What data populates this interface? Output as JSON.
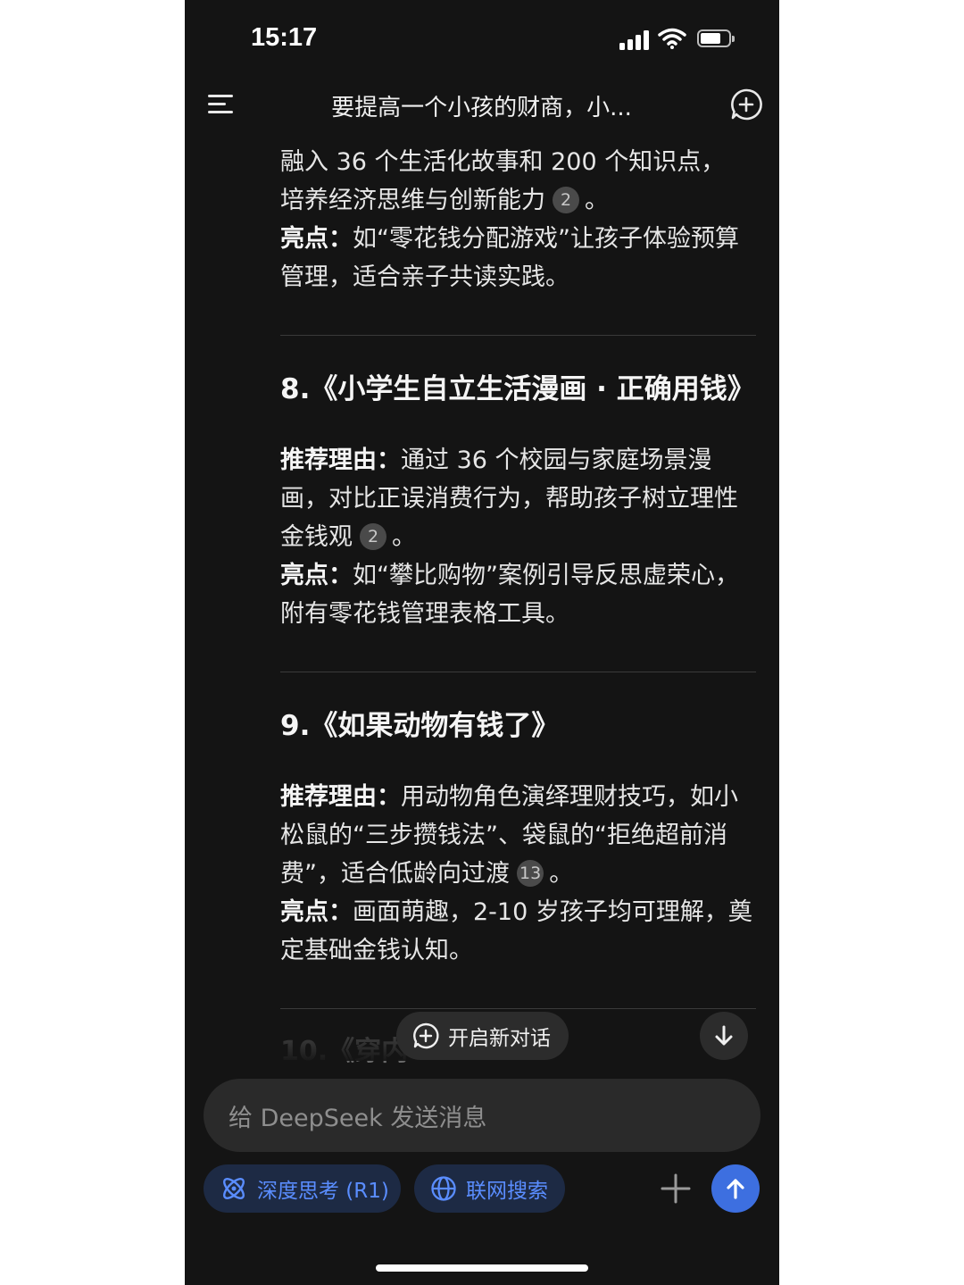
{
  "status_bar": {
    "time": "15:17"
  },
  "header": {
    "title": "要提高一个小孩的财商，小..."
  },
  "article": {
    "intro_line1": "融入 36 个生活化故事和 200 个知识点，",
    "intro_line2": "培养经济思维与创新能力",
    "intro_cite": "2",
    "intro_end": "。",
    "intro_highlight_label": "亮点：",
    "intro_highlight_text": "如“零花钱分配游戏”让孩子体验预算管理，适合亲子共读实践。",
    "book8": {
      "title": "8.《小学生自立生活漫画 · 正确用钱》",
      "reason_label": "推荐理由：",
      "reason_text": "通过 36 个校园与家庭场景漫画，对比正误消费行为，帮助孩子树立理性金钱观",
      "reason_cite": "2",
      "reason_end": "。",
      "highlight_label": "亮点：",
      "highlight_text": "如“攀比购物”案例引导反思虚荣心，附有零花钱管理表格工具。"
    },
    "book9": {
      "title": "9.《如果动物有钱了》",
      "reason_label": "推荐理由：",
      "reason_text": "用动物角色演绎理财技巧，如小松鼠的“三步攒钱法”、袋鼠的“拒绝超前消费”，适合低龄向过渡",
      "reason_cite": "13",
      "reason_end": "。",
      "highlight_label": "亮点：",
      "highlight_text": "画面萌趣，2-10 岁孩子均可理解，奠定基础金钱认知。"
    },
    "book10_partial": "10.《穿内"
  },
  "floating": {
    "new_chat_label": "开启新对话"
  },
  "composer": {
    "placeholder": "给 DeepSeek 发送消息",
    "deep_think_label": "深度思考 (R1)",
    "web_search_label": "联网搜索"
  },
  "colors": {
    "accent": "#3d6fe0",
    "chip_text": "#5a8dff",
    "background": "#141414"
  }
}
